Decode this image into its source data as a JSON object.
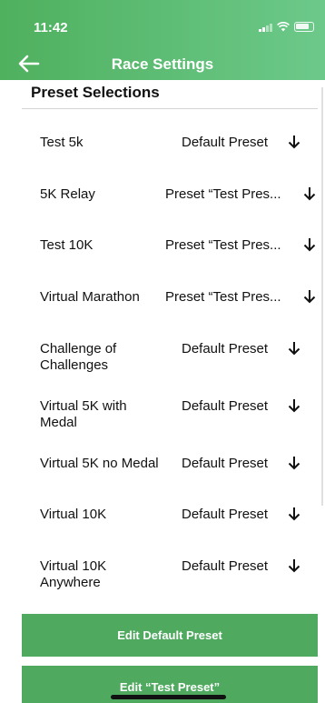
{
  "status": {
    "time": "11:42"
  },
  "header": {
    "title": "Race Settings"
  },
  "section_title": "Preset Selections",
  "races": [
    {
      "name": "Test 5k",
      "preset": "Default Preset"
    },
    {
      "name": "5K Relay",
      "preset": "Preset “Test Pres..."
    },
    {
      "name": "Test 10K",
      "preset": "Preset “Test Pres..."
    },
    {
      "name": "Virtual Marathon",
      "preset": "Preset “Test Pres..."
    },
    {
      "name": "Challenge of Challenges",
      "preset": "Default Preset"
    },
    {
      "name": "Virtual 5K with Medal",
      "preset": "Default Preset"
    },
    {
      "name": "Virtual 5K no Medal",
      "preset": "Default Preset"
    },
    {
      "name": "Virtual 10K",
      "preset": "Default Preset"
    },
    {
      "name": "Virtual 10K Anywhere",
      "preset": "Default Preset"
    }
  ],
  "buttons": {
    "edit_default": "Edit Default Preset",
    "edit_test": "Edit “Test Preset”"
  },
  "colors": {
    "accent": "#4faa60",
    "header_start": "#4fb05e",
    "header_end": "#6cc98a"
  }
}
